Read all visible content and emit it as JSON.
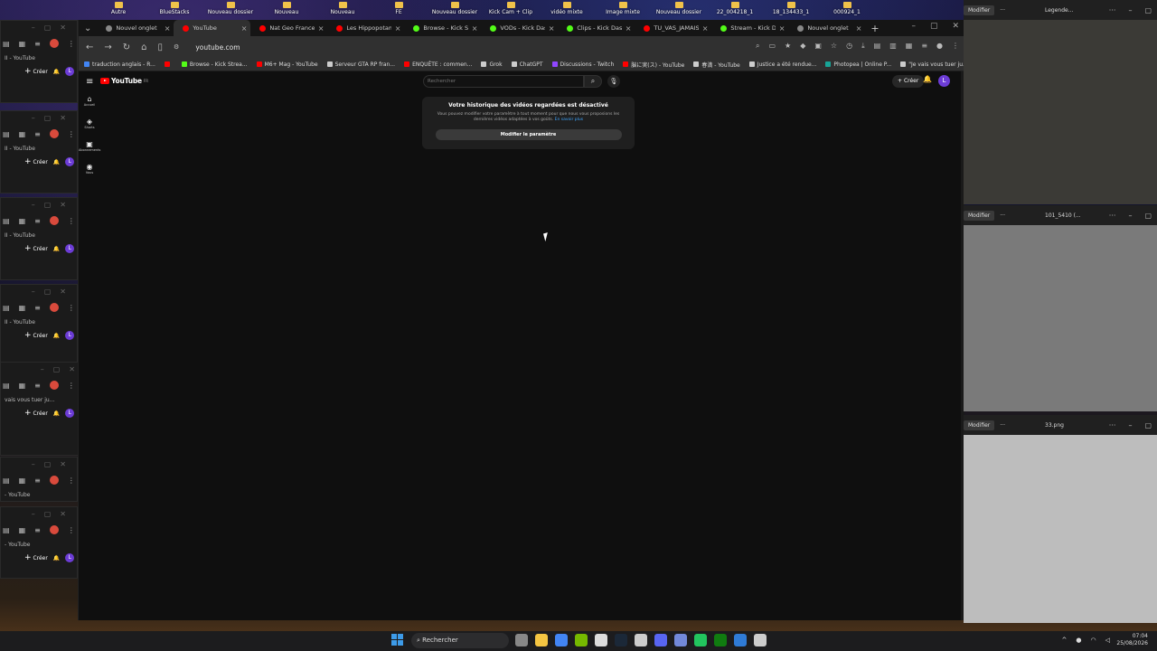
{
  "desktop": {
    "icons": [
      "Autre",
      "BlueStacks",
      "Nouveau dossier",
      "Nouveau",
      "Nouveau",
      "FE",
      "Nouveau dossier",
      "Kick Cam + Clip",
      "vidéo mixte",
      "Image mixte",
      "Nouveau dossier",
      "22_004218_1",
      "18_134433_1",
      "000924_1"
    ]
  },
  "left_windows": [
    {
      "title": "II - YouTube",
      "create": "Créer",
      "avatar": "L"
    },
    {
      "title": "II - YouTube",
      "create": "Créer",
      "avatar": "L"
    },
    {
      "title": "II - YouTube",
      "create": "Créer",
      "avatar": "L"
    },
    {
      "title": "II - YouTube",
      "create": "Créer",
      "avatar": "L"
    },
    {
      "title": "vais vous tuer ju...",
      "create": "Créer",
      "avatar": "L"
    },
    {
      "title": "- YouTube",
      "create": "",
      "avatar": ""
    },
    {
      "title": "- YouTube",
      "create": "Créer",
      "avatar": "L"
    }
  ],
  "browser": {
    "tabs": [
      {
        "label": "Nouvel onglet",
        "color": "#888888"
      },
      {
        "label": "YouTube",
        "color": "#ff0000",
        "active": true
      },
      {
        "label": "Nat Geo France -",
        "color": "#ff0000"
      },
      {
        "label": "Les Hippopotames",
        "color": "#ff0000"
      },
      {
        "label": "Browse - Kick Strea",
        "color": "#53fc18"
      },
      {
        "label": "VODs - Kick Dashb",
        "color": "#53fc18"
      },
      {
        "label": "Clips - Kick Dashb",
        "color": "#53fc18"
      },
      {
        "label": "TU_VAS_JAMAIS_",
        "color": "#ff0000"
      },
      {
        "label": "Stream - Kick Das",
        "color": "#53fc18"
      },
      {
        "label": "Nouvel onglet",
        "color": "#888888"
      }
    ],
    "url": "youtube.com",
    "bookmarks": [
      {
        "label": "traduction anglais - R...",
        "color": "#4285f4"
      },
      {
        "label": "",
        "color": "#ff0000"
      },
      {
        "label": "Browse - Kick Strea...",
        "color": "#53fc18"
      },
      {
        "label": "M6+ Mag - YouTube",
        "color": "#ff0000"
      },
      {
        "label": "Serveur GTA RP fran...",
        "color": "#cccccc"
      },
      {
        "label": "ENQUÊTE : commen...",
        "color": "#ff0000"
      },
      {
        "label": "Grok",
        "color": "#cccccc"
      },
      {
        "label": "ChatGPT",
        "color": "#cccccc"
      },
      {
        "label": "Discussions - Twitch",
        "color": "#9146ff"
      },
      {
        "label": "脳に実(ス) - YouTube",
        "color": "#ff0000"
      },
      {
        "label": "春満 - YouTube",
        "color": "#cccccc"
      },
      {
        "label": "Justice a été rendue...",
        "color": "#cccccc"
      },
      {
        "label": "Photopea | Online P...",
        "color": "#18a497"
      },
      {
        "label": "\"Je vais vous tuer ju...",
        "color": "#cccccc"
      }
    ]
  },
  "youtube": {
    "logo": "YouTube",
    "logo_country": "FR",
    "search_placeholder": "Rechercher",
    "create_label": "Créer",
    "avatar": "L",
    "guide": [
      {
        "label": "Accueil"
      },
      {
        "label": "Shorts"
      },
      {
        "label": "Abonnements"
      },
      {
        "label": "Vous"
      }
    ],
    "history_card": {
      "title": "Votre historique des vidéos regardées est désactivé",
      "description": "Vous pouvez modifier votre paramètre à tout moment pour que nous vous proposions les dernières vidéos adaptées à vos goûts.",
      "link": "En savoir plus",
      "button": "Modifier le paramètre"
    }
  },
  "viewers": [
    {
      "modify": "Modifier",
      "name": "Legende...",
      "image_color": "#3b3a36"
    },
    {
      "modify": "Modifier",
      "name": "101_5410 (...",
      "image_color": "#7a7a7a"
    },
    {
      "modify": "Modifier",
      "name": "33.png",
      "image_color": "#bdbdbd"
    }
  ],
  "taskbar": {
    "search": "Rechercher",
    "time": "07:04",
    "date": "25/08/2026"
  }
}
